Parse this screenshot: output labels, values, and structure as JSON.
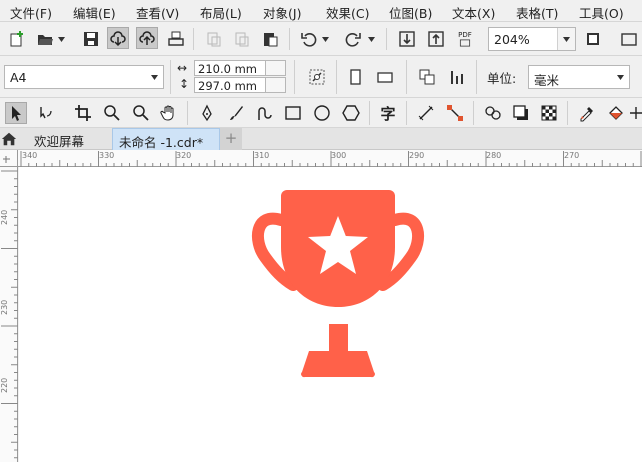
{
  "menu": [
    "文件(F)",
    "编辑(E)",
    "查看(V)",
    "布局(L)",
    "对象(J)",
    "效果(C)",
    "位图(B)",
    "文本(X)",
    "表格(T)",
    "工具(O)"
  ],
  "toolbar": {
    "pdf_label": "PDF",
    "zoom": "204%"
  },
  "property_bar": {
    "page_size": "A4",
    "width": "210.0 mm",
    "height": "297.0 mm",
    "unit_label": "单位:",
    "unit_value": "毫米"
  },
  "toolbox": {
    "text_tool_glyph": "字"
  },
  "tabs": {
    "home_icon": "home-icon",
    "welcome": "欢迎屏幕",
    "document": "未命名 -1.cdr*",
    "add_tab": "+"
  },
  "rulers": {
    "horizontal": [
      "340",
      "330",
      "320",
      "310",
      "300",
      "290",
      "280",
      "270"
    ],
    "vertical": [
      "240",
      "230",
      "220"
    ]
  },
  "colors": {
    "trophy": "#ff6149",
    "star": "#ffffff",
    "tab_active": "#cfe3f7"
  }
}
